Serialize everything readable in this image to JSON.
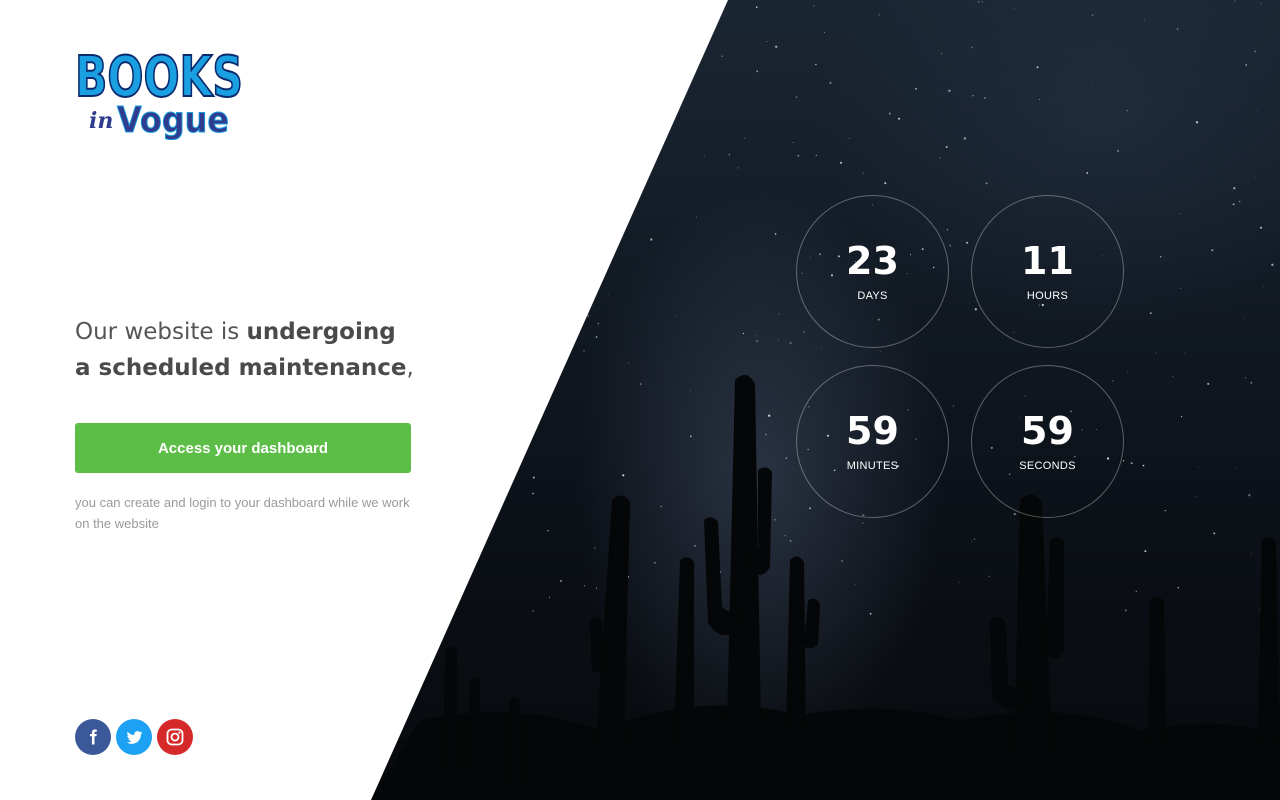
{
  "brand": {
    "logo_top": "BOOKS",
    "logo_small": "in",
    "logo_bottom": "Vogue",
    "top_color": "#1a9fe0",
    "bottom_color": "#303d8f"
  },
  "message": {
    "part1": "Our website is ",
    "bold1": "undergoing",
    "bold2": "a scheduled maintenance",
    "trail": ","
  },
  "cta": {
    "label": "Access your dashboard",
    "color": "#5cbd47"
  },
  "note": "you can create and login to your dashboard while we work on the website",
  "countdown": {
    "days": {
      "value": "23",
      "label": "DAYS"
    },
    "hours": {
      "value": "11",
      "label": "HOURS"
    },
    "minutes": {
      "value": "59",
      "label": "MINUTES"
    },
    "seconds": {
      "value": "59",
      "label": "SECONDS"
    }
  },
  "social": [
    {
      "name": "facebook-icon",
      "color": "#3b5998"
    },
    {
      "name": "twitter-icon",
      "color": "#1da1f2"
    },
    {
      "name": "instagram-icon",
      "color": "#d62a2a"
    }
  ]
}
